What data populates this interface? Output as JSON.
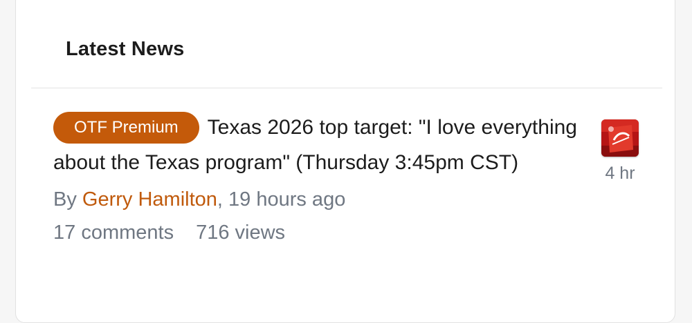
{
  "section": {
    "title": "Latest News"
  },
  "article": {
    "badge": "OTF Premium",
    "headline": "Texas 2026 top target: \"I love everything about the Texas program\" (Thursday 3:45pm CST)",
    "byline_prefix": "By ",
    "author": "Gerry Hamilton",
    "byline_suffix": ", 19 hours ago",
    "comments": "17 comments",
    "views": "716 views",
    "thumbnail_icon": "user-avatar-icon",
    "time_ago": "4 hr"
  },
  "colors": {
    "badge_bg": "#c45a0a",
    "author_link": "#c05a0c",
    "meta_text": "#6f7782"
  }
}
